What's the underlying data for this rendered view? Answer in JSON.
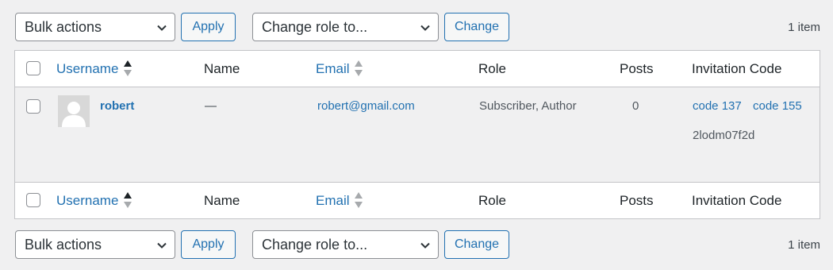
{
  "toolbar_top": {
    "bulk_select": "Bulk actions",
    "apply_label": "Apply",
    "role_select": "Change role to...",
    "change_label": "Change",
    "item_count": "1 item"
  },
  "toolbar_bottom": {
    "bulk_select": "Bulk actions",
    "apply_label": "Apply",
    "role_select": "Change role to...",
    "change_label": "Change",
    "item_count": "1 item"
  },
  "columns": {
    "username": "Username",
    "name": "Name",
    "email": "Email",
    "role": "Role",
    "posts": "Posts",
    "invitation_code": "Invitation Code"
  },
  "rows": [
    {
      "username": "robert",
      "name": "—",
      "email": "robert@gmail.com",
      "role": "Subscriber, Author",
      "posts": "0",
      "codes": [
        "code 137",
        "code 155"
      ],
      "code_value": "2lodm07f2d"
    }
  ],
  "colors": {
    "link": "#2271b1",
    "background": "#f0f0f1",
    "row_highlight": "#f0f0f1",
    "border": "#c3c4c7"
  },
  "icons": {
    "sort": "sort-arrows-icon",
    "dropdown": "chevron-down-icon",
    "avatar": "default-avatar-icon"
  }
}
